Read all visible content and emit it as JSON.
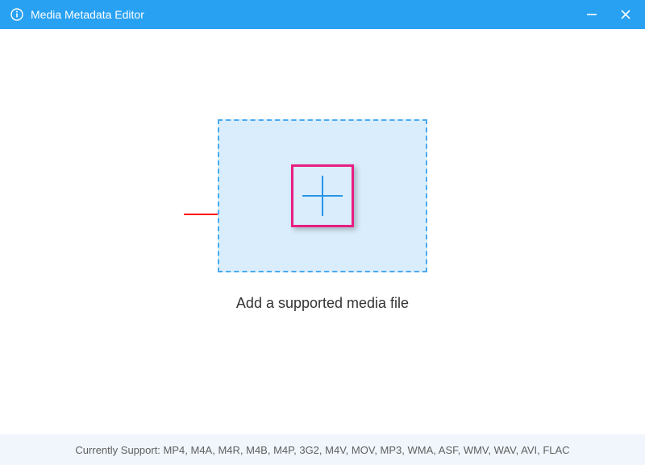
{
  "titlebar": {
    "title": "Media Metadata Editor"
  },
  "main": {
    "dropzone_label": "Add a supported media file"
  },
  "footer": {
    "prefix": "Currently Support: ",
    "formats": "MP4, M4A, M4R, M4B, M4P, 3G2, M4V, MOV, MP3, WMA, ASF, WMV, WAV, AVI, FLAC"
  },
  "annotation": {
    "highlight_color": "#e91e82",
    "arrow_color": "#ff0000"
  }
}
